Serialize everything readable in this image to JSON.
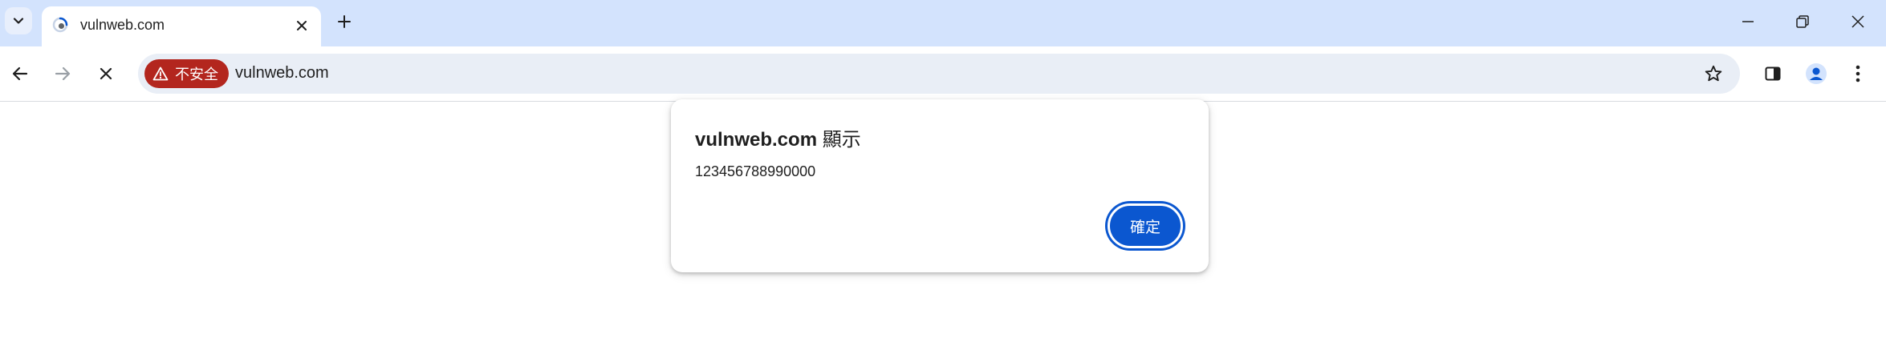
{
  "browser": {
    "tab": {
      "title": "vulnweb.com",
      "favicon": "loading-favicon-icon"
    },
    "toolbar": {
      "security_label": "不安全",
      "url": "vulnweb.com",
      "security_color": "#b3261e"
    },
    "colors": {
      "tabstrip_bg": "#d3e3fd",
      "omnibox_bg": "#e9eef6",
      "accent": "#0b57d0"
    }
  },
  "dialog": {
    "origin": "vulnweb.com",
    "title_suffix": "顯示",
    "message": "123456788990000",
    "ok_label": "確定"
  }
}
